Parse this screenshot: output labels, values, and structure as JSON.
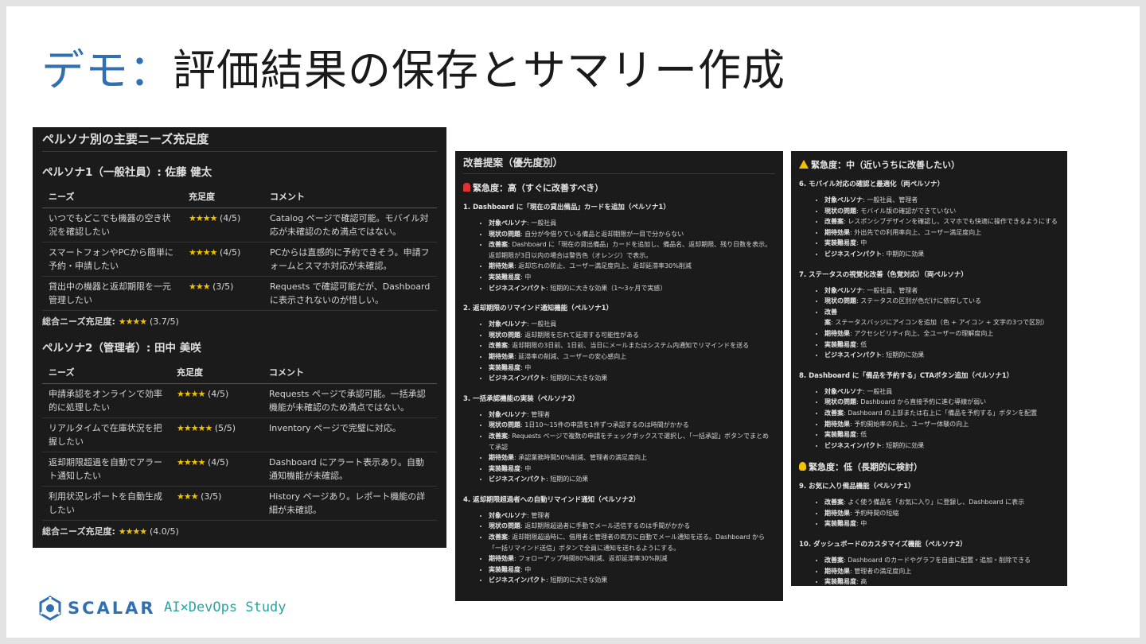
{
  "slide": {
    "title_accent": "デモ：",
    "title_rest": "評価結果の保存とサマリー作成"
  },
  "footer": {
    "logo_text": "SCALAR",
    "study_text": "AI×DevOps Study"
  },
  "colors": {
    "accent": "#2f6fb2",
    "panel_bg": "#1b1b1b",
    "star": "#f2c200",
    "study": "#2aa3a3"
  },
  "persona_panel": {
    "heading": "ペルソナ別の主要ニーズ充足度",
    "personas": [
      {
        "title": "ペルソナ1（一般社員）: 佐藤 健太",
        "headers": [
          "ニーズ",
          "充足度",
          "コメント"
        ],
        "rows": [
          {
            "need": "いつでもどこでも機器の空き状況を確認したい",
            "stars": "★★★★",
            "rating": "(4/5)",
            "comment": "Catalog ページで確認可能。モバイル対応が未確認のため満点ではない。"
          },
          {
            "need": "スマートフォンやPCから簡単に予約・申請したい",
            "stars": "★★★★",
            "rating": "(4/5)",
            "comment": "PCからは直感的に予約できそう。申請フォームとスマホ対応が未確認。"
          },
          {
            "need": "貸出中の機器と返却期限を一元管理したい",
            "stars": "★★★",
            "rating": "(3/5)",
            "comment": "Requests で確認可能だが、Dashboard に表示されないのが惜しい。"
          }
        ],
        "total_label": "総合ニーズ充足度:",
        "total_stars": "★★★★",
        "total_value": "(3.7/5)"
      },
      {
        "title": "ペルソナ2（管理者）: 田中 美咲",
        "headers": [
          "ニーズ",
          "充足度",
          "コメント"
        ],
        "rows": [
          {
            "need": "申請承認をオンラインで効率的に処理したい",
            "stars": "★★★★",
            "rating": "(4/5)",
            "comment": "Requests ページで承認可能。一括承認機能が未確認のため満点ではない。"
          },
          {
            "need": "リアルタイムで在庫状況を把握したい",
            "stars": "★★★★★",
            "rating": "(5/5)",
            "comment": "Inventory ページで完璧に対応。"
          },
          {
            "need": "返却期限超過を自動でアラート通知したい",
            "stars": "★★★★",
            "rating": "(4/5)",
            "comment": "Dashboard にアラート表示あり。自動通知機能が未確認。"
          },
          {
            "need": "利用状況レポートを自動生成したい",
            "stars": "★★★",
            "rating": "(3/5)",
            "comment": "History ページあり。レポート機能の詳細が未確認。"
          }
        ],
        "total_label": "総合ニーズ充足度:",
        "total_stars": "★★★★",
        "total_value": "(4.0/5)"
      }
    ]
  },
  "improvement_panel": {
    "heading": "改善提案（優先度別）",
    "urgency_high": "緊急度：高（すぐに改善すべき）",
    "items": [
      {
        "title": "1. Dashboard に「現在の貸出備品」カードを追加（ペルソナ1）",
        "props": [
          [
            "対象ペルソナ",
            ": 一般社員"
          ],
          [
            "現状の問題",
            ": 自分が今借りている備品と返却期限が一目で分からない"
          ],
          [
            "改善案",
            ": Dashboard に「現在の貸出備品」カードを追加し、備品名、返却期限、残り日数を表示。返却期限が3日以内の場合は警告色（オレンジ）で表示。"
          ],
          [
            "期待効果",
            ": 返却忘れの防止、ユーザー満足度向上、返却延滞率30%削減"
          ],
          [
            "実装難易度",
            ": 中"
          ],
          [
            "ビジネスインパクト",
            ": 短期的に大きな効果（1〜3ヶ月で実感）"
          ]
        ]
      },
      {
        "title": "2. 返却期限のリマインド通知機能（ペルソナ1）",
        "props": [
          [
            "対象ペルソナ",
            ": 一般社員"
          ],
          [
            "現状の問題",
            ": 返却期限を忘れて延滞する可能性がある"
          ],
          [
            "改善案",
            ": 返却期限の3日前、1日前、当日にメールまたはシステム内通知でリマインドを送る"
          ],
          [
            "期待効果",
            ": 延滞率の削減、ユーザーの安心感向上"
          ],
          [
            "実装難易度",
            ": 中"
          ],
          [
            "ビジネスインパクト",
            ": 短期的に大きな効果"
          ]
        ]
      },
      {
        "title": "3. 一括承認機能の実装（ペルソナ2）",
        "props": [
          [
            "対象ペルソナ",
            ": 管理者"
          ],
          [
            "現状の問題",
            ": 1日10〜15件の申請を1件ずつ承認するのは時間がかかる"
          ],
          [
            "改善案",
            ": Requests ページで複数の申請をチェックボックスで選択し、「一括承認」ボタンでまとめて承認"
          ],
          [
            "期待効果",
            ": 承認業務時間50%削減、管理者の満足度向上"
          ],
          [
            "実装難易度",
            ": 中"
          ],
          [
            "ビジネスインパクト",
            ": 短期的に効果"
          ]
        ]
      },
      {
        "title": "4. 返却期限超過者への自動リマインド通知（ペルソナ2）",
        "props": [
          [
            "対象ペルソナ",
            ": 管理者"
          ],
          [
            "現状の問題",
            ": 返却期限超過者に手動でメール送信するのは手間がかかる"
          ],
          [
            "改善案",
            ": 返却期限超過時に、借用者と管理者の両方に自動でメール通知を送る。Dashboard から「一括リマインド送信」ボタンで全員に通知を送れるようにする。"
          ],
          [
            "期待効果",
            ": フォローアップ時間80%削減、返却延滞率30%削減"
          ],
          [
            "実装難易度",
            ": 中"
          ],
          [
            "ビジネスインパクト",
            ": 短期的に大きな効果"
          ]
        ]
      }
    ]
  },
  "improvement_panel_2": {
    "urgency_mid": "緊急度：中（近いうちに改善したい）",
    "mid_items": [
      {
        "title": "6. モバイル対応の確認と最適化（両ペルソナ）",
        "props": [
          [
            "対象ペルソナ",
            ": 一般社員、管理者"
          ],
          [
            "現状の問題",
            ": モバイル版の確認ができていない"
          ],
          [
            "改善案",
            ": レスポンシブデザインを確認し、スマホでも快適に操作できるようにする"
          ],
          [
            "期待効果",
            ": 外出先での利用率向上、ユーザー満足度向上"
          ],
          [
            "実装難易度",
            ": 中"
          ],
          [
            "ビジネスインパクト",
            ": 中期的に効果"
          ]
        ]
      },
      {
        "title": "7. ステータスの視覚化改善（色覚対応）（両ペルソナ）",
        "props": [
          [
            "対象ペルソナ",
            ": 一般社員、管理者"
          ],
          [
            "現状の問題",
            ": ステータスの区別が色だけに依存している"
          ],
          [
            "改善案",
            ": ステータスバッジにアイコンを追加（色 + アイコン + 文字の3つで区別）"
          ],
          [
            "期待効果",
            ": アクセシビリティ向上、全ユーザーの理解度向上"
          ],
          [
            "実装難易度",
            ": 低"
          ],
          [
            "ビジネスインパクト",
            ": 短期的に効果"
          ]
        ]
      },
      {
        "title": "8. Dashboard に「備品を予約する」CTAボタン追加（ペルソナ1）",
        "props": [
          [
            "対象ペルソナ",
            ": 一般社員"
          ],
          [
            "現状の問題",
            ": Dashboard から直接予約に進む導線が弱い"
          ],
          [
            "改善案",
            ": Dashboard の上部または右上に「備品を予約する」ボタンを配置"
          ],
          [
            "期待効果",
            ": 予約開始率の向上、ユーザー体験の向上"
          ],
          [
            "実装難易度",
            ": 低"
          ],
          [
            "ビジネスインパクト",
            ": 短期的に効果"
          ]
        ]
      }
    ],
    "urgency_low": "緊急度：低（長期的に検討）",
    "low_items": [
      {
        "title": "9. お気に入り備品機能（ペルソナ1）",
        "props": [
          [
            "改善案",
            ": よく使う備品を「お気に入り」に登録し、Dashboard に表示"
          ],
          [
            "期待効果",
            ": 予約時間の短縮"
          ],
          [
            "実装難易度",
            ": 中"
          ]
        ]
      },
      {
        "title": "10. ダッシュボードのカスタマイズ機能（ペルソナ2）",
        "props": [
          [
            "改善案",
            ": Dashboard のカードやグラフを自由に配置・追加・削除できる"
          ],
          [
            "期待効果",
            ": 管理者の満足度向上"
          ],
          [
            "実装難易度",
            ": 高"
          ]
        ]
      }
    ]
  }
}
